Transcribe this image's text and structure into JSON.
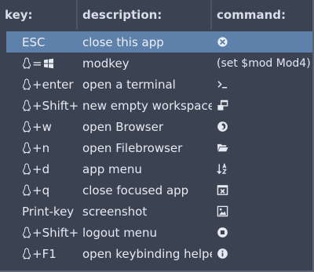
{
  "header": {
    "key": "key:",
    "description": "description:",
    "command": "command:"
  },
  "rows": [
    {
      "key": "ESC",
      "key_prefix": "",
      "description": "close this app",
      "command_icon": "close-circle-icon",
      "command_text": ""
    },
    {
      "key": "=",
      "key_prefix": "tux",
      "key_suffix_icon": "windows-icon",
      "description": "modkey",
      "command_icon": "",
      "command_text": "(set $mod Mod4)"
    },
    {
      "key": "+enter",
      "key_prefix": "tux",
      "description": "open a terminal",
      "command_icon": "terminal-icon",
      "command_text": ""
    },
    {
      "key": "+Shift+n",
      "key_prefix": "tux",
      "description": "new empty workspace",
      "command_icon": "windows-stack-icon",
      "command_text": ""
    },
    {
      "key": "+w",
      "key_prefix": "tux",
      "description": "open Browser",
      "command_icon": "firefox-icon",
      "command_text": ""
    },
    {
      "key": "+n",
      "key_prefix": "tux",
      "description": "open Filebrowser",
      "command_icon": "folder-open-icon",
      "command_text": ""
    },
    {
      "key": "+d",
      "key_prefix": "tux",
      "description": "app menu",
      "command_icon": "sort-alpha-icon",
      "command_text": ""
    },
    {
      "key": "+q",
      "key_prefix": "tux",
      "description": "close focused app",
      "command_icon": "window-close-icon",
      "command_text": ""
    },
    {
      "key": "Print-key",
      "key_prefix": "",
      "description": "screenshot",
      "command_icon": "image-icon",
      "command_text": ""
    },
    {
      "key": "+Shift+e",
      "key_prefix": "tux",
      "description": "logout menu",
      "command_icon": "stop-circle-icon",
      "command_text": ""
    },
    {
      "key": "+F1",
      "key_prefix": "tux",
      "description": "open keybinding helper",
      "command_icon": "info-circle-icon",
      "command_text": ""
    }
  ],
  "colors": {
    "background": "#3b4252",
    "selected_row": "#5e81ac",
    "text": "#e5e9f0"
  }
}
